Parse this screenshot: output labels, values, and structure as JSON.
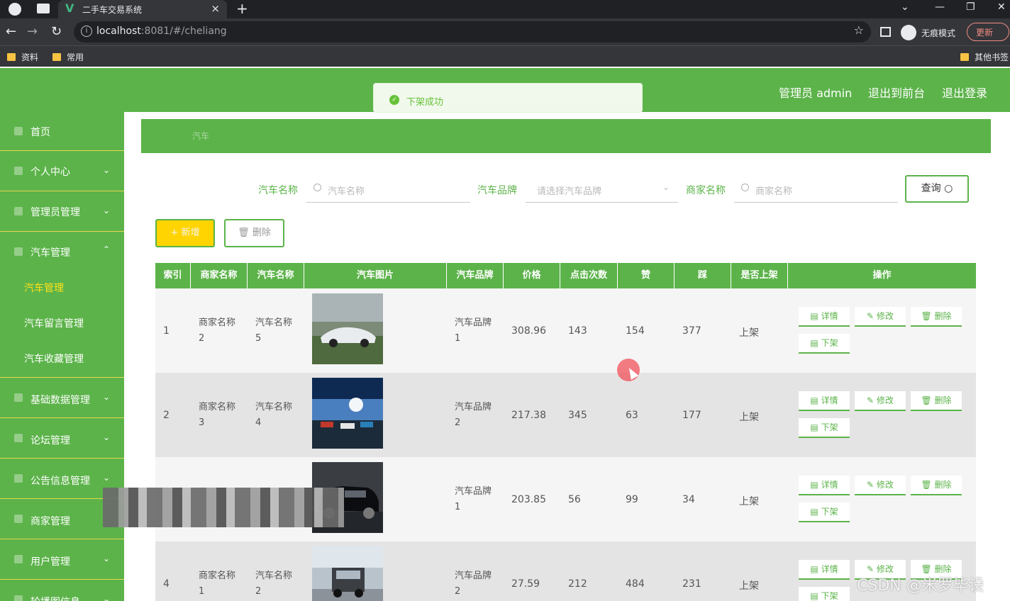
{
  "browser": {
    "tab_title": "二手车交易系统",
    "url_host": "localhost",
    "url_rest": ":8081/#/cheliang",
    "incognito_label": "无痕模式",
    "update_label": "更新",
    "bookmarks": [
      "资料",
      "常用"
    ],
    "other_bookmarks": "其他书签"
  },
  "header": {
    "admin_label": "管理员 admin",
    "front_link": "退出到前台",
    "logout_link": "退出登录"
  },
  "toast": {
    "message": "下架成功"
  },
  "sidebar": {
    "items": [
      {
        "label": "首页"
      },
      {
        "label": "个人中心"
      },
      {
        "label": "管理员管理"
      },
      {
        "label": "汽车管理"
      },
      {
        "label": "基础数据管理"
      },
      {
        "label": "论坛管理"
      },
      {
        "label": "公告信息管理"
      },
      {
        "label": "商家管理"
      },
      {
        "label": "用户管理"
      },
      {
        "label": "轮播图信息"
      }
    ],
    "sub_items": [
      {
        "label": "汽车管理"
      },
      {
        "label": "汽车留言管理"
      },
      {
        "label": "汽车收藏管理"
      }
    ]
  },
  "breadcrumb": {
    "current": "汽车"
  },
  "search": {
    "car_name_label": "汽车名称",
    "car_name_placeholder": "汽车名称",
    "brand_label": "汽车品牌",
    "brand_placeholder": "请选择汽车品牌",
    "merchant_label": "商家名称",
    "merchant_placeholder": "商家名称",
    "query_label": "查询"
  },
  "actions": {
    "add_label": "+ 新增",
    "delete_label": "删除"
  },
  "table": {
    "headers": [
      "索引",
      "商家名称",
      "汽车名称",
      "汽车图片",
      "汽车品牌",
      "价格",
      "点击次数",
      "赞",
      "踩",
      "是否上架",
      "操作"
    ],
    "ops": {
      "detail": "详情",
      "edit": "修改",
      "delete": "删除",
      "offshelf": "下架"
    },
    "rows": [
      {
        "index": "1",
        "merchant": [
          "商家名称",
          "2"
        ],
        "car": [
          "汽车名称",
          "5"
        ],
        "brand": [
          "汽车品牌",
          "1"
        ],
        "price": "308.96",
        "clicks": "143",
        "likes": "154",
        "dislikes": "377",
        "status": "上架"
      },
      {
        "index": "2",
        "merchant": [
          "商家名称",
          "3"
        ],
        "car": [
          "汽车名称",
          "4"
        ],
        "brand": [
          "汽车品牌",
          "2"
        ],
        "price": "217.38",
        "clicks": "345",
        "likes": "63",
        "dislikes": "177",
        "status": "上架"
      },
      {
        "index": "",
        "merchant": [
          "",
          ""
        ],
        "car": [
          "",
          ""
        ],
        "brand": [
          "汽车品牌",
          "1"
        ],
        "price": "203.85",
        "clicks": "56",
        "likes": "99",
        "dislikes": "34",
        "status": "上架"
      },
      {
        "index": "4",
        "merchant": [
          "商家名称",
          "1"
        ],
        "car": [
          "汽车名称",
          "2"
        ],
        "brand": [
          "汽车品牌",
          "2"
        ],
        "price": "27.59",
        "clicks": "212",
        "likes": "484",
        "dislikes": "231",
        "status": "上架"
      }
    ]
  },
  "watermark": "CSDN @米罗毕设",
  "colors": {
    "primary": "#5cb34a",
    "accent": "#ffd400",
    "active_menu": "#ffe21a"
  }
}
